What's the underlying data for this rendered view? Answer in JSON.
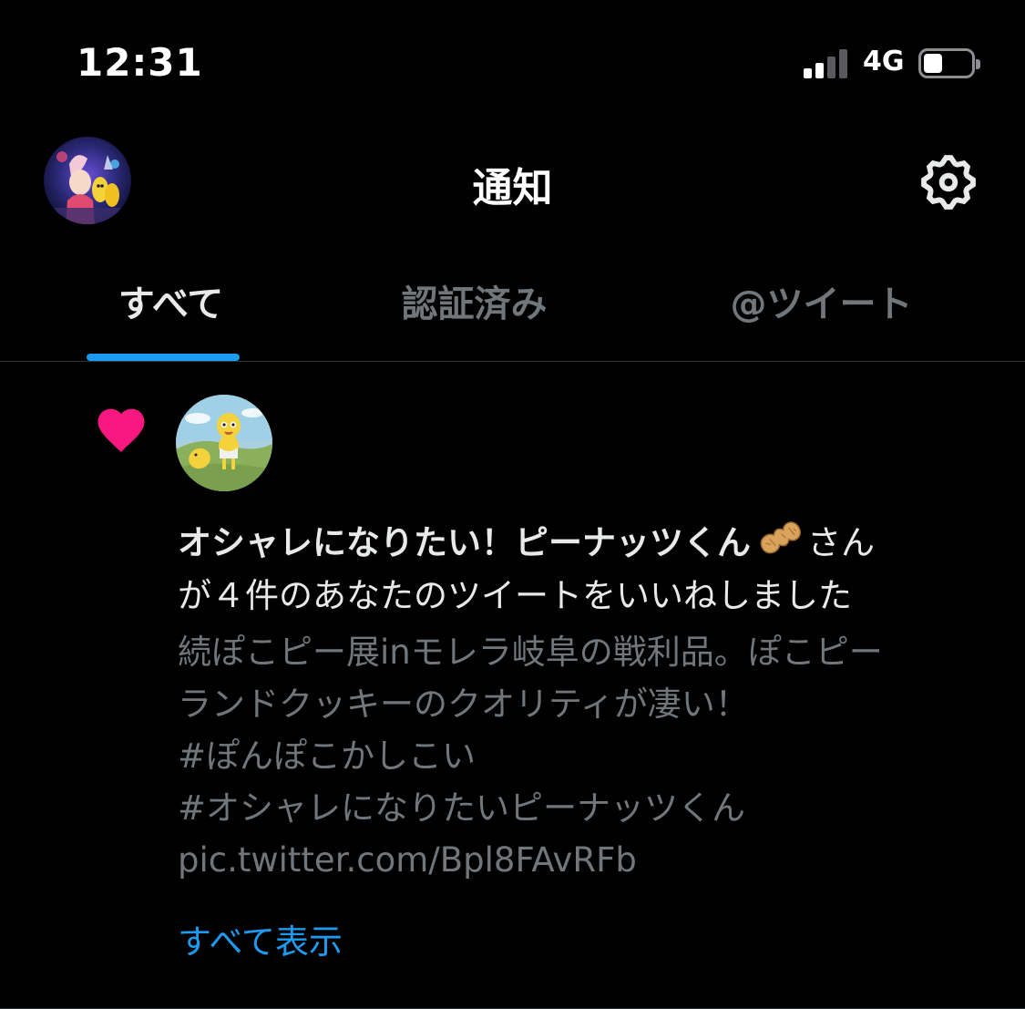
{
  "status_bar": {
    "time": "12:31",
    "network": "4G",
    "signal_bars_active": 2,
    "signal_bars_total": 4,
    "battery_level": 0.4
  },
  "header": {
    "title": "通知",
    "avatar_icon": "profile-avatar-icon",
    "settings_icon": "gear-icon"
  },
  "tabs": [
    {
      "label": "すべて",
      "active": true
    },
    {
      "label": "認証済み",
      "active": false
    },
    {
      "label": "@ツイート",
      "active": false
    }
  ],
  "notification": {
    "icon": "heart-icon",
    "user_name": "オシャレになりたい！ピーナッツくん",
    "emoji": "peanut-icon",
    "suffix": "さん",
    "message": "が４件のあなたのツイートをいいねしました",
    "tweet_text": "続ぽこピー展inモレラ岐阜の戦利品。ぽこピー\nランドクッキーのクオリティが凄い！\n#ぽんぽこかしこい\n#オシャレになりたいピーナッツくん\npic.twitter.com/Bpl8FAvRFb",
    "show_all": "すべて表示"
  },
  "colors": {
    "background": "#000000",
    "accent": "#1d9bf0",
    "heart": "#f91880",
    "muted_text": "#71767b",
    "primary_text": "#e7e9ea"
  }
}
